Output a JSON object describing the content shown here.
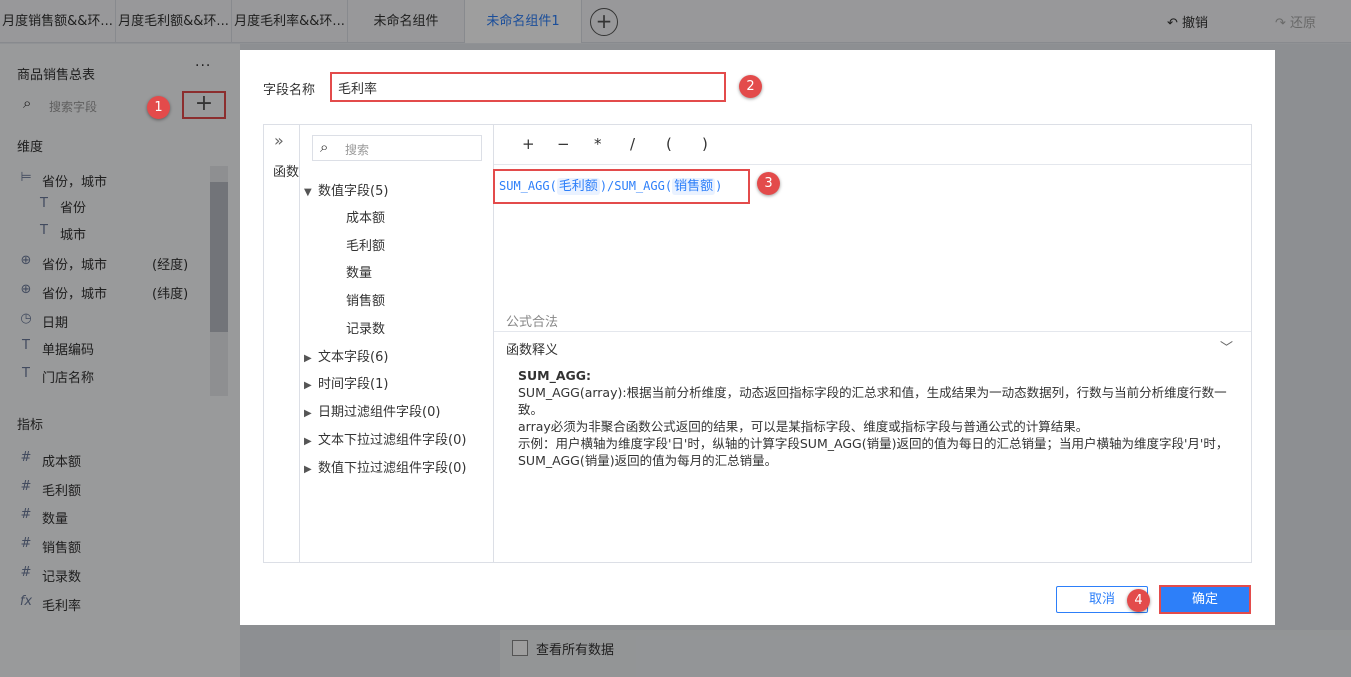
{
  "tabs": [
    {
      "label": "月度销售额&&环..."
    },
    {
      "label": "月度毛利额&&环..."
    },
    {
      "label": "月度毛利率&&环..."
    },
    {
      "label": "未命名组件"
    },
    {
      "label": "未命名组件1"
    }
  ],
  "toolbar": {
    "undo": "撤销",
    "redo": "还原"
  },
  "left_panel": {
    "title": "商品销售总表",
    "more": "···",
    "search_placeholder": "搜索字段",
    "dimension_title": "维度",
    "dimensions": [
      {
        "label": "省份，城市",
        "suffix": "",
        "icon": "hierarchy-icon"
      },
      {
        "label": "省份",
        "suffix": "",
        "icon": "text-type-icon"
      },
      {
        "label": "城市",
        "suffix": "",
        "icon": "text-type-icon"
      },
      {
        "label": "省份，城市",
        "suffix": "(经度)",
        "icon": "globe-icon"
      },
      {
        "label": "省份，城市",
        "suffix": "(纬度)",
        "icon": "globe-icon"
      },
      {
        "label": "日期",
        "suffix": "",
        "icon": "clock-icon"
      },
      {
        "label": "单据编码",
        "suffix": "",
        "icon": "text-type-icon"
      },
      {
        "label": "门店名称",
        "suffix": "",
        "icon": "text-type-icon"
      }
    ],
    "metric_title": "指标",
    "metrics": [
      {
        "label": "成本额",
        "icon": "number-icon"
      },
      {
        "label": "毛利额",
        "icon": "number-icon"
      },
      {
        "label": "数量",
        "icon": "number-icon"
      },
      {
        "label": "销售额",
        "icon": "number-icon"
      },
      {
        "label": "记录数",
        "icon": "number-icon"
      },
      {
        "label": "毛利率",
        "icon": "formula-icon"
      }
    ]
  },
  "dialog": {
    "field_name_label": "字段名称",
    "field_name_value": "毛利率",
    "func_label": "函数",
    "tree_search_placeholder": "搜索",
    "tree": [
      {
        "label": "数值字段(5)",
        "expanded": true,
        "children": [
          "成本额",
          "毛利额",
          "数量",
          "销售额",
          "记录数"
        ]
      },
      {
        "label": "文本字段(6)",
        "expanded": false
      },
      {
        "label": "时间字段(1)",
        "expanded": false
      },
      {
        "label": "日期过滤组件字段(0)",
        "expanded": false
      },
      {
        "label": "文本下拉过滤组件字段(0)",
        "expanded": false
      },
      {
        "label": "数值下拉过滤组件字段(0)",
        "expanded": false
      }
    ],
    "operators": [
      "+",
      "−",
      "*",
      "/",
      "(",
      ")"
    ],
    "formula": {
      "fn1": "SUM_AGG(",
      "field1": "毛利额",
      "mid": ")/SUM_AGG(",
      "field2": "销售额",
      "end": ")"
    },
    "validation": "公式合法",
    "func_def_title": "函数释义",
    "help": {
      "title": "SUM_AGG:",
      "line1": "SUM_AGG(array):根据当前分析维度，动态返回指标字段的汇总求和值，生成结果为一动态数据列，行数与当前分析维度行数一致。",
      "line2": " array必须为非聚合函数公式返回的结果，可以是某指标字段、维度或指标字段与普通公式的计算结果。",
      "line3": " 示例：用户横轴为维度字段'日'时，纵轴的计算字段SUM_AGG(销量)返回的值为每日的汇总销量；当用户横轴为维度字段'月'时，SUM_AGG(销量)返回的值为每月的汇总销量。"
    },
    "cancel": "取消",
    "ok": "确定"
  },
  "steps": [
    "1",
    "2",
    "3",
    "4"
  ],
  "bottom": {
    "view_all": "查看所有数据"
  },
  "colors": {
    "accent": "#2d7ff9",
    "highlight": "#e34b4b"
  }
}
